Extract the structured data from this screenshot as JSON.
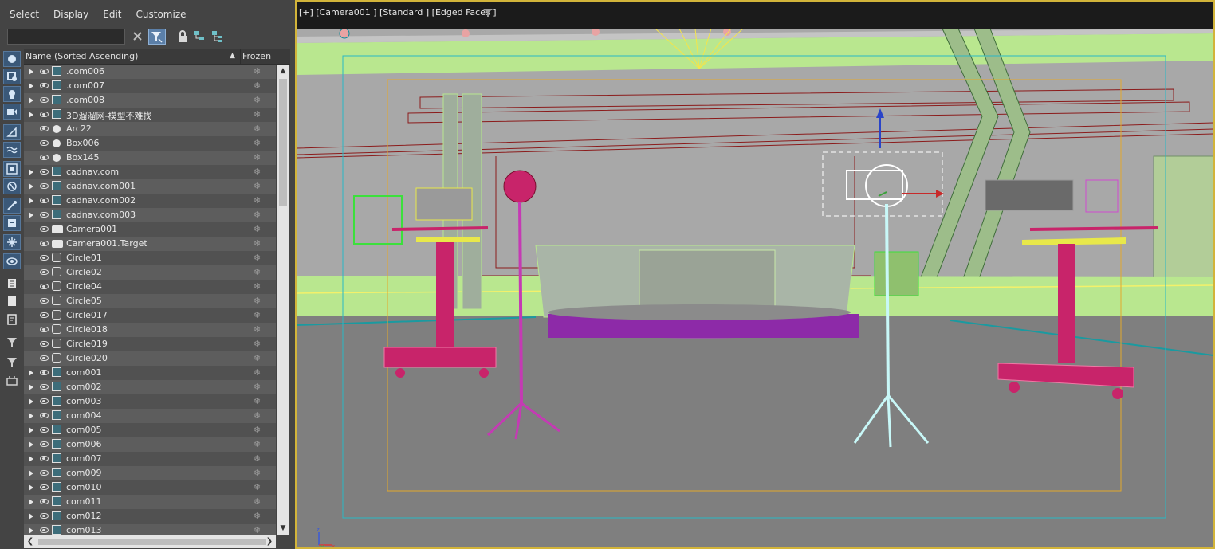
{
  "menu": {
    "items": [
      "Select",
      "Display",
      "Edit",
      "Customize"
    ]
  },
  "search": {
    "value": ""
  },
  "list": {
    "header_name": "Name (Sorted Ascending)",
    "header_frozen": "Frozen",
    "sort_arrow": "▲",
    "freeze_glyph": "❄",
    "rows": [
      {
        "name": ".com006",
        "type": "geometry",
        "expandable": true
      },
      {
        "name": ".com007",
        "type": "geometry",
        "expandable": true
      },
      {
        "name": ".com008",
        "type": "geometry",
        "expandable": true
      },
      {
        "name": "3D溜溜网-模型不难找",
        "type": "geometry",
        "expandable": true
      },
      {
        "name": "Arc22",
        "type": "sphere",
        "expandable": false
      },
      {
        "name": "Box006",
        "type": "sphere",
        "expandable": false
      },
      {
        "name": "Box145",
        "type": "sphere",
        "expandable": false
      },
      {
        "name": "cadnav.com",
        "type": "geometry",
        "expandable": true
      },
      {
        "name": "cadnav.com001",
        "type": "geometry",
        "expandable": true
      },
      {
        "name": "cadnav.com002",
        "type": "geometry",
        "expandable": true
      },
      {
        "name": "cadnav.com003",
        "type": "geometry",
        "expandable": true
      },
      {
        "name": "Camera001",
        "type": "camera",
        "expandable": false
      },
      {
        "name": "Camera001.Target",
        "type": "camera",
        "expandable": false
      },
      {
        "name": "Circle01",
        "type": "shape",
        "expandable": false
      },
      {
        "name": "Circle02",
        "type": "shape",
        "expandable": false
      },
      {
        "name": "Circle04",
        "type": "shape",
        "expandable": false
      },
      {
        "name": "Circle05",
        "type": "shape",
        "expandable": false
      },
      {
        "name": "Circle017",
        "type": "shape",
        "expandable": false
      },
      {
        "name": "Circle018",
        "type": "shape",
        "expandable": false
      },
      {
        "name": "Circle019",
        "type": "shape",
        "expandable": false
      },
      {
        "name": "Circle020",
        "type": "shape",
        "expandable": false
      },
      {
        "name": "com001",
        "type": "geometry",
        "expandable": true
      },
      {
        "name": "com002",
        "type": "geometry",
        "expandable": true
      },
      {
        "name": "com003",
        "type": "geometry",
        "expandable": true
      },
      {
        "name": "com004",
        "type": "geometry",
        "expandable": true
      },
      {
        "name": "com005",
        "type": "geometry",
        "expandable": true
      },
      {
        "name": "com006",
        "type": "geometry",
        "expandable": true
      },
      {
        "name": "com007",
        "type": "geometry",
        "expandable": true
      },
      {
        "name": "com009",
        "type": "geometry",
        "expandable": true
      },
      {
        "name": "com010",
        "type": "geometry",
        "expandable": true
      },
      {
        "name": "com011",
        "type": "geometry",
        "expandable": true
      },
      {
        "name": "com012",
        "type": "geometry",
        "expandable": true
      },
      {
        "name": "com013",
        "type": "geometry",
        "expandable": true
      }
    ]
  },
  "side_toolbar": {
    "icons": [
      "display-geometry-icon",
      "display-shapes-icon",
      "display-lights-icon",
      "display-cameras-icon",
      "display-helpers-icon",
      "display-spacewarps-icon",
      "display-groups-icon",
      "display-xrefs-icon",
      "display-bones-icon",
      "display-containers-icon",
      "display-frozen-icon",
      "display-hidden-icon",
      "display-all-icon",
      "display-none-icon",
      "invert-display-icon",
      "filter-icon",
      "select-filter-icon",
      "layer-icon"
    ]
  },
  "scrollbar": {
    "up": "▲",
    "down": "▼",
    "left": "❮",
    "right": "❯"
  },
  "viewport": {
    "label": "[+] [Camera001 ] [Standard ] [Edged Faces ]",
    "axis_labels": {
      "z": "z",
      "y": "y",
      "x": "x"
    },
    "colors": {
      "frame": "#d2b43a",
      "safe_frame": "#29b8c6",
      "floor": "#7f7f7f",
      "wall": "#a7a7a7",
      "selected": "#ffffff"
    }
  }
}
